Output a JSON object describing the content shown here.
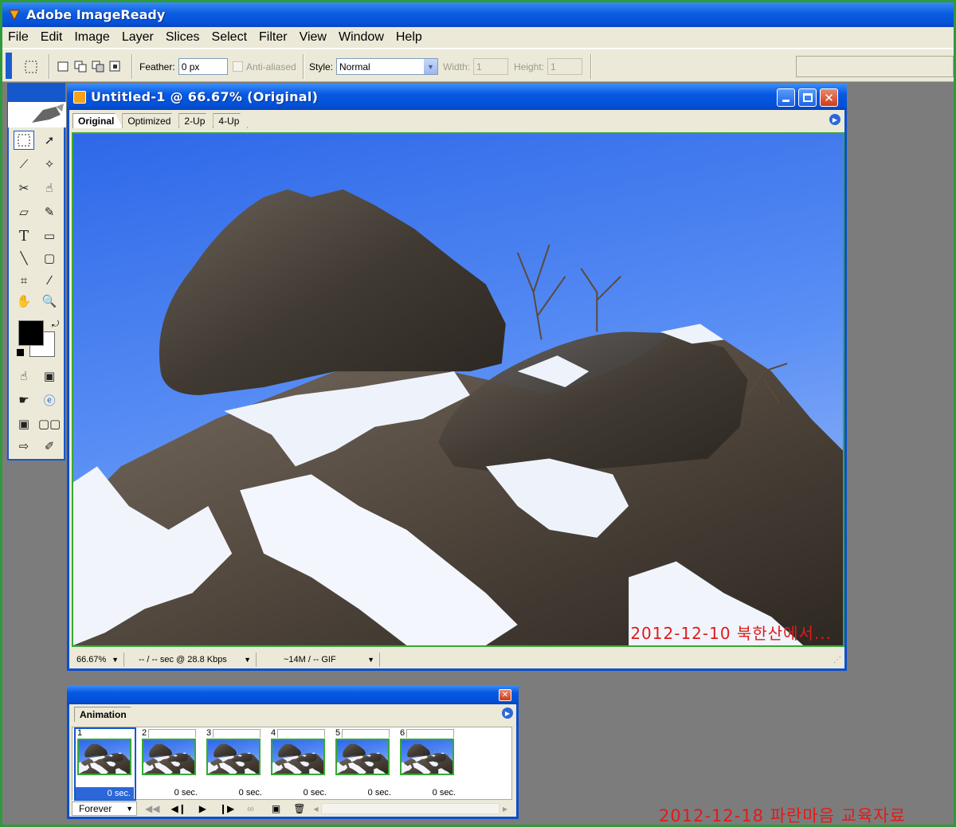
{
  "app": {
    "title": "Adobe ImageReady"
  },
  "menu": [
    "File",
    "Edit",
    "Image",
    "Layer",
    "Slices",
    "Select",
    "Filter",
    "View",
    "Window",
    "Help"
  ],
  "options": {
    "feather_label": "Feather:",
    "feather_value": "0 px",
    "antialiased_label": "Anti-aliased",
    "style_label": "Style:",
    "style_value": "Normal",
    "width_label": "Width:",
    "width_value": "1",
    "height_label": "Height:",
    "height_value": "1"
  },
  "document": {
    "title": "Untitled-1 @ 66.67% (Original)",
    "tabs": [
      "Original",
      "Optimized",
      "2-Up",
      "4-Up"
    ],
    "active_tab": "Original",
    "zoom": "66.67%",
    "download": "-- / -- sec @ 28.8 Kbps",
    "size_format": "~14M / -- GIF",
    "watermark": "2012-12-10 북한산에서..."
  },
  "tools": {
    "type_tool": "T"
  },
  "animation": {
    "tab": "Animation",
    "frames": [
      {
        "num": "1",
        "delay": "0 sec."
      },
      {
        "num": "2",
        "delay": "0 sec."
      },
      {
        "num": "3",
        "delay": "0 sec."
      },
      {
        "num": "4",
        "delay": "0 sec."
      },
      {
        "num": "5",
        "delay": "0 sec."
      },
      {
        "num": "6",
        "delay": "0 sec."
      }
    ],
    "loop": "Forever"
  },
  "note": "2012-12-18 파란마음 교육자료",
  "colors": {
    "accent": "#0a4fd0",
    "frame_border": "#2e9a3c",
    "watermark": "#e01b1b",
    "sky": "#4d7ff0"
  }
}
